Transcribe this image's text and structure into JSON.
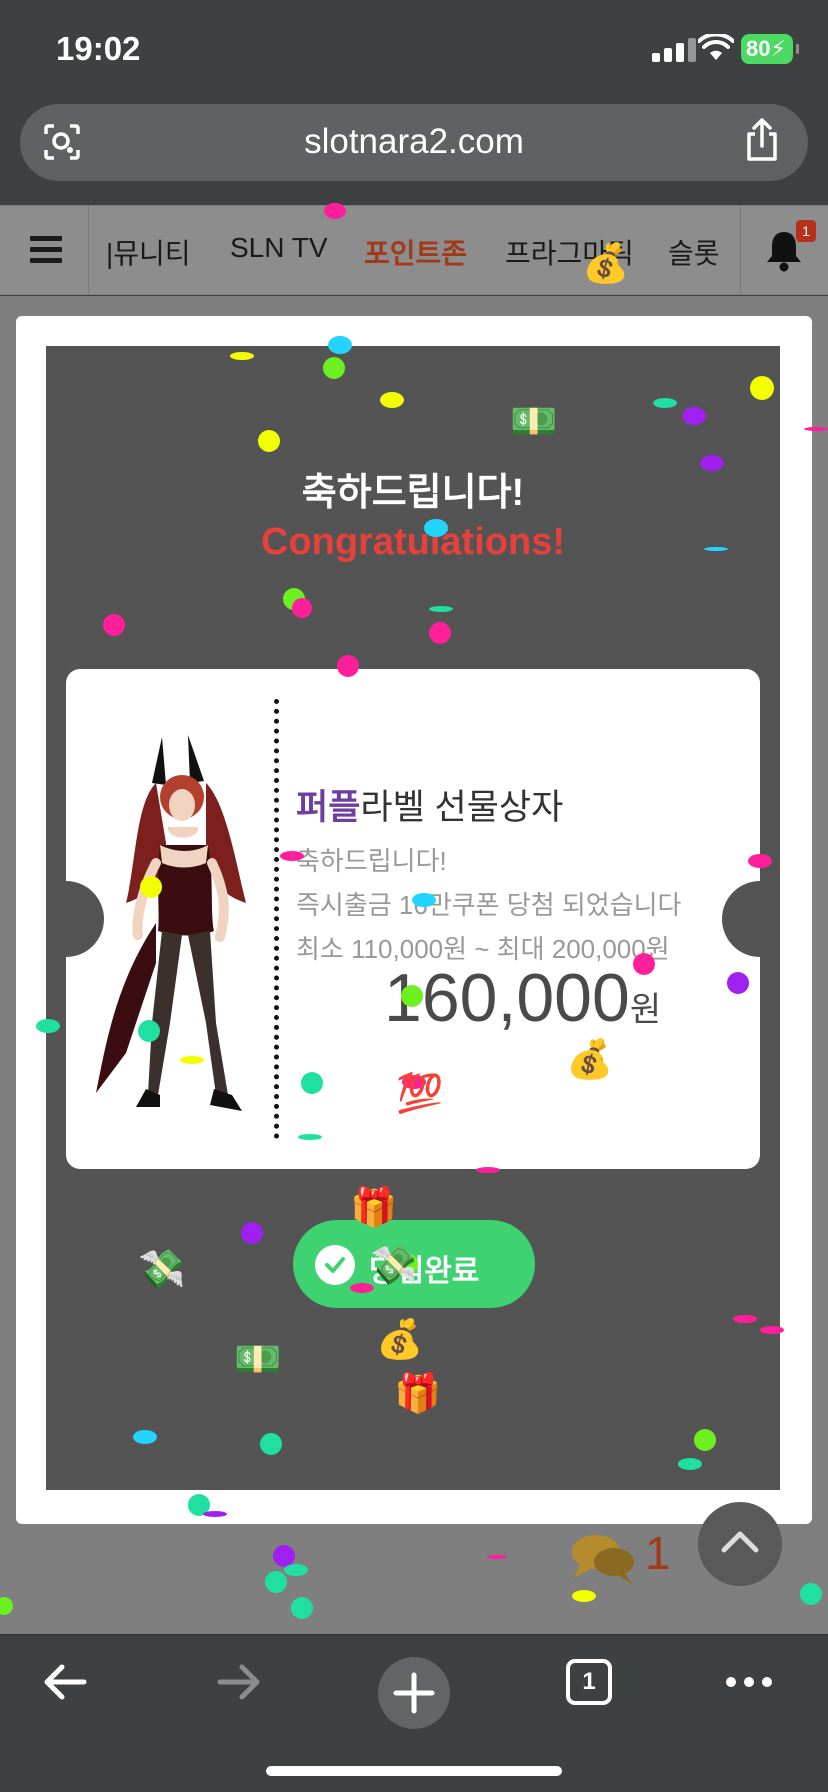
{
  "status_bar": {
    "time": "19:02",
    "battery": "80"
  },
  "browser": {
    "url": "slotnara2.com",
    "tabs_count": "1"
  },
  "site_nav": {
    "items": [
      {
        "label": "|뮤니티"
      },
      {
        "label": "SLN TV"
      },
      {
        "label": "포인트존",
        "active": true
      },
      {
        "label": "프라그마틱"
      },
      {
        "label": "슬롯"
      }
    ],
    "bell_badge": "1"
  },
  "modal": {
    "heading_ko": "축하드립니다!",
    "heading_en": "Congratulations!",
    "ticket": {
      "title_accent": "퍼플",
      "title_rest": "라벨 선물상자",
      "line1": "축하드립니다!",
      "line2": "즉시출금 16만쿠폰 당첨 되었습니다",
      "line3": "최소 110,000원 ~ 최대 200,000원",
      "amount": "160,000",
      "unit": "원"
    },
    "button_label": "당첨완료"
  },
  "floating": {
    "chat_count": "1"
  },
  "colors": {
    "accent_red": "#e8413b",
    "accent_purple": "#6b3fa0",
    "success_green": "#3ed271",
    "nav_active": "#a2391a"
  }
}
